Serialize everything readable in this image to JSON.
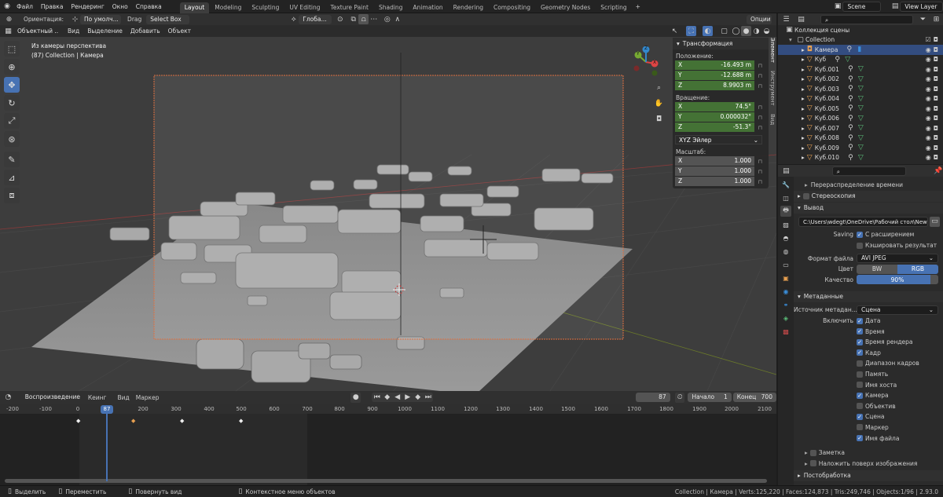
{
  "topbar": {
    "menus": [
      "Файл",
      "Правка",
      "Рендеринг",
      "Окно",
      "Справка"
    ],
    "workspaces": [
      "Layout",
      "Modeling",
      "Sculpting",
      "UV Editing",
      "Texture Paint",
      "Shading",
      "Animation",
      "Rendering",
      "Compositing",
      "Geometry Nodes",
      "Scripting"
    ],
    "active_workspace": "Layout",
    "add_tab": "+",
    "scene": "Scene",
    "view_layer": "View Layer"
  },
  "tool_header": {
    "orientation_label": "Ориентация:",
    "orientation_value": "По умолч...",
    "drag_label": "Drag",
    "drag_value": "Select Box",
    "transform_orientation": "Глоба...",
    "options": "Опции"
  },
  "viewport_header": {
    "mode": "Объектный ...",
    "menus": [
      "Вид",
      "Выделение",
      "Добавить",
      "Объект"
    ]
  },
  "viewport": {
    "view_name": "Из камеры перспектива",
    "collection_info": "(87) Collection | Камера",
    "axis_x": "X",
    "axis_y": "Y",
    "axis_z": "Z"
  },
  "npanel": {
    "title": "Трансформация",
    "location_label": "Положение:",
    "location": [
      {
        "axis": "X",
        "value": "-16.493 m"
      },
      {
        "axis": "Y",
        "value": "-12.688 m"
      },
      {
        "axis": "Z",
        "value": "8.9903 m"
      }
    ],
    "rotation_label": "Вращение:",
    "rotation": [
      {
        "axis": "X",
        "value": "74.5°"
      },
      {
        "axis": "Y",
        "value": "0.000032°"
      },
      {
        "axis": "Z",
        "value": "-51.3°"
      }
    ],
    "rotation_mode": "XYZ Эйлер",
    "scale_label": "Масштаб:",
    "scale": [
      {
        "axis": "X",
        "value": "1.000"
      },
      {
        "axis": "Y",
        "value": "1.000"
      },
      {
        "axis": "Z",
        "value": "1.000"
      }
    ],
    "tabs": [
      "Элемент",
      "Инструмент",
      "Вид"
    ]
  },
  "timeline": {
    "playback": "Воспроизведение",
    "keying": "Кеинг",
    "view": "Вид",
    "marker": "Маркер",
    "current_frame": "87",
    "start_label": "Начало",
    "start": "1",
    "end_label": "Конец",
    "end": "700",
    "ruler": [
      "-200",
      "-100",
      "0",
      "87",
      "200",
      "300",
      "400",
      "500",
      "600",
      "700",
      "800",
      "900",
      "1000",
      "1100",
      "1200",
      "1300",
      "1400",
      "1500",
      "1600",
      "1700",
      "1800",
      "1900",
      "2000",
      "2100"
    ]
  },
  "statusbar": {
    "select": "Выделить",
    "move": "Переместить",
    "rotate": "Повернуть вид",
    "context": "Контекстное меню объектов",
    "stats": "Collection | Камера | Verts:125,220 | Faces:124,873 | Tris:249,746 | Objects:1/96 | 2.93.0"
  },
  "outliner": {
    "root": "Коллекция сцены",
    "collection": "Collection",
    "items": [
      "Камера",
      "Куб",
      "Куб.001",
      "Куб.002",
      "Куб.003",
      "Куб.004",
      "Куб.005",
      "Куб.006",
      "Куб.007",
      "Куб.008",
      "Куб.009",
      "Куб.010"
    ]
  },
  "properties": {
    "time_remap": "Перераспределение времени",
    "stereo": "Стереоскопия",
    "output": "Вывод",
    "path": "C:\\Users\\wdegt\\OneDrive\\Рабочий стол\\New Fol...",
    "saving_label": "Saving",
    "extension": "С расширением",
    "cache": "Кэшировать результат",
    "format_label": "Формат файла",
    "format": "AVI JPEG",
    "color_label": "Цвет",
    "bw": "BW",
    "rgb": "RGB",
    "quality_label": "Качество",
    "quality": "90%",
    "quality_fraction": 0.9,
    "metadata": "Метаданные",
    "meta_source_label": "Источник метадан...",
    "meta_source": "Сцена",
    "include_label": "Включить",
    "include": [
      {
        "label": "Дата",
        "on": true
      },
      {
        "label": "Время",
        "on": true
      },
      {
        "label": "Время рендера",
        "on": true
      },
      {
        "label": "Кадр",
        "on": true
      },
      {
        "label": "Диапазон кадров",
        "on": false
      },
      {
        "label": "Память",
        "on": false
      },
      {
        "label": "Имя хоста",
        "on": false
      },
      {
        "label": "Камера",
        "on": true
      },
      {
        "label": "Объектив",
        "on": false
      },
      {
        "label": "Сцена",
        "on": true
      },
      {
        "label": "Маркер",
        "on": false
      },
      {
        "label": "Имя файла",
        "on": true
      }
    ],
    "note": "Заметка",
    "burn": "Наложить поверх изображения",
    "post": "Постобработка"
  }
}
